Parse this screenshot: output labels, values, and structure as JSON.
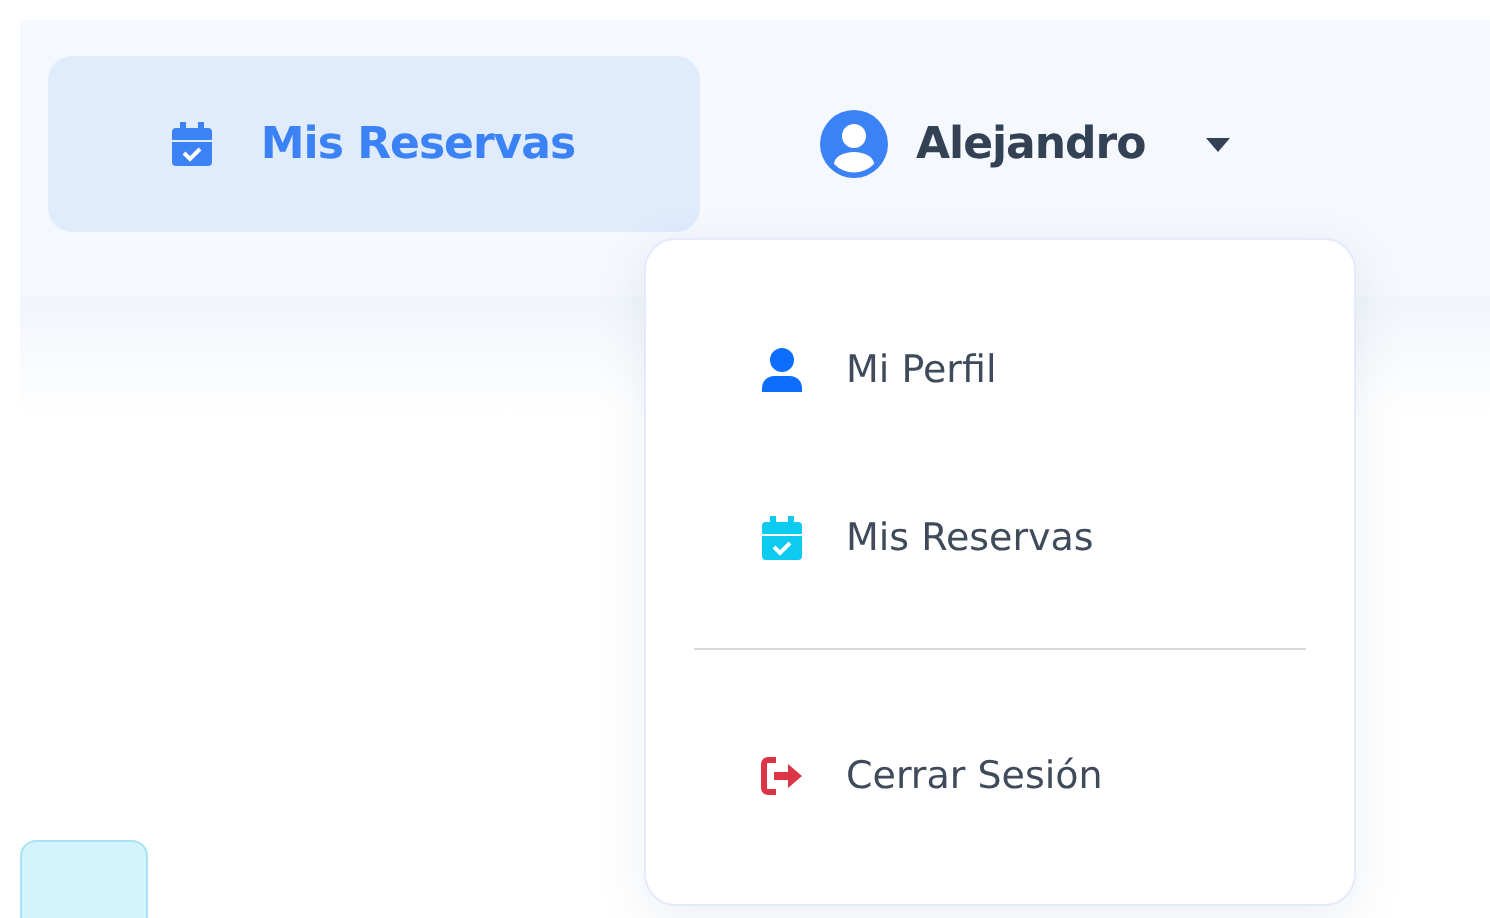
{
  "nav": [
    {
      "label": "Mis Reservas",
      "kind": "bookings",
      "selected": true
    }
  ],
  "user_menu": {
    "name": "Alejandro",
    "expanded": true,
    "items": [
      {
        "kind": "profile",
        "label": "Mi Perfil",
        "color": "#0d6efd"
      },
      {
        "kind": "bookings",
        "label": "Mis Reservas",
        "color": "#0dcaf0"
      },
      {
        "kind": "divider"
      },
      {
        "kind": "logout",
        "label": "Cerrar Sesión",
        "color": "#dc3545"
      }
    ]
  }
}
